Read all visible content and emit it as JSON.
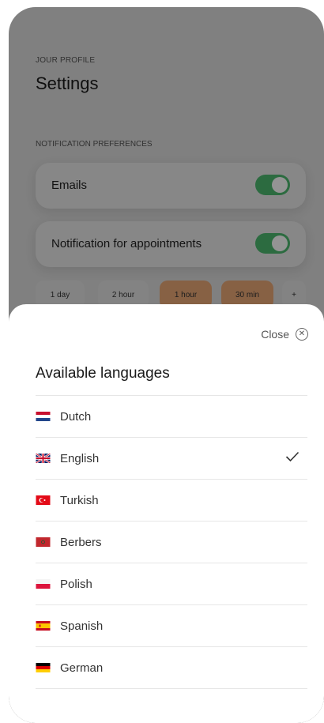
{
  "profile": {
    "eyebrow": "JOUR PROFILE",
    "title": "Settings"
  },
  "notifications": {
    "section_label": "NOTIFICATION PREFERENCES",
    "emails": {
      "label": "Emails",
      "enabled": true
    },
    "appointments": {
      "label": "Notification for appointments",
      "enabled": true
    },
    "reminder_options": [
      {
        "label": "1 day",
        "selected": false
      },
      {
        "label": "2 hour",
        "selected": false
      },
      {
        "label": "1 hour",
        "selected": true
      },
      {
        "label": "30 min",
        "selected": true
      },
      {
        "label": "+",
        "selected": false
      }
    ]
  },
  "language_sheet": {
    "close_label": "Close",
    "close_icon": "close-circle-icon",
    "title": "Available languages",
    "selected": "English",
    "languages": [
      {
        "label": "Dutch",
        "flag": "netherlands-flag-icon"
      },
      {
        "label": "English",
        "flag": "uk-flag-icon"
      },
      {
        "label": "Turkish",
        "flag": "turkey-flag-icon"
      },
      {
        "label": "Berbers",
        "flag": "morocco-flag-icon"
      },
      {
        "label": "Polish",
        "flag": "poland-flag-icon"
      },
      {
        "label": "Spanish",
        "flag": "spain-flag-icon"
      },
      {
        "label": "German",
        "flag": "germany-flag-icon"
      }
    ]
  },
  "colors": {
    "toggle_on": "#4cb86f",
    "chip_selected": "#e9a776",
    "overlay": "rgba(0,0,0,0.42)"
  }
}
